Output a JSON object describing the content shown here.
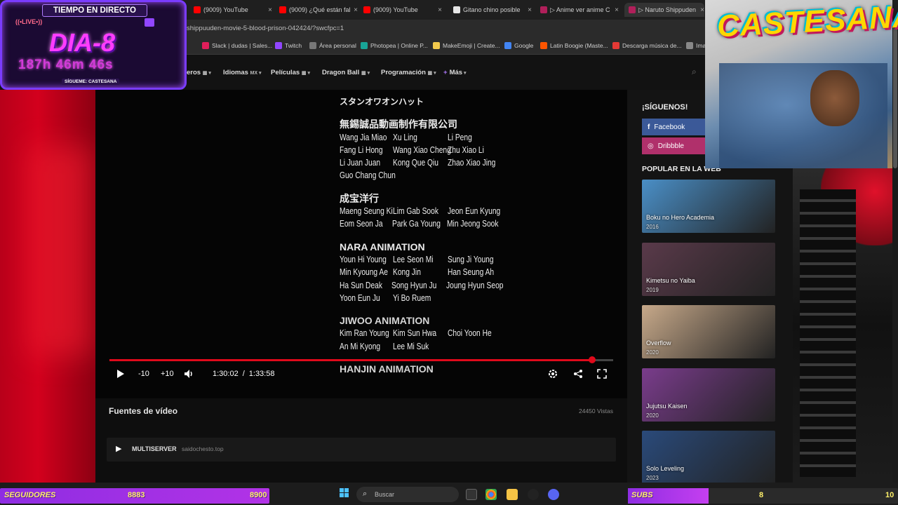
{
  "browser": {
    "tabs": [
      {
        "label": "(9009) YouTube",
        "color": "#ff0000"
      },
      {
        "label": "(9009) ¿Qué están fal",
        "color": "#ff0000"
      },
      {
        "label": "(9009) YouTube",
        "color": "#ff0000"
      },
      {
        "label": "Gitano chino posible",
        "color": "#e6e6e6"
      },
      {
        "label": "▷ Anime ver anime C",
        "color": "#b01f5a"
      },
      {
        "label": "▷ Naruto Shippuden",
        "color": "#b01f5a"
      }
    ],
    "url": "shippuuden-movie-5-blood-prison-042424/?swcfpc=1",
    "bookmarks": [
      {
        "label": "Slack | dudas | Sales...",
        "color": "#e01e5a"
      },
      {
        "label": "Twitch",
        "color": "#9146ff"
      },
      {
        "label": "Área personal",
        "color": "#777777"
      },
      {
        "label": "Photopea | Online P...",
        "color": "#18a497"
      },
      {
        "label": "MakeEmoji | Create...",
        "color": "#f2c94c"
      },
      {
        "label": "Google",
        "color": "#4285f4"
      },
      {
        "label": "Latin Boogie (Maste...",
        "color": "#ff5500"
      },
      {
        "label": "Descarga música de...",
        "color": "#e53935"
      },
      {
        "label": "Ima",
        "color": "#888888"
      }
    ]
  },
  "site_nav": {
    "items": [
      {
        "label": "eros",
        "badge": "▦"
      },
      {
        "label": "Idiomas",
        "badge": "MX"
      },
      {
        "label": "Películas",
        "badge": "▦"
      },
      {
        "label": "Dragon Ball",
        "badge": "▦"
      },
      {
        "label": "Programación",
        "badge": "▦"
      },
      {
        "label": "Más",
        "badge": "+"
      }
    ]
  },
  "credits": {
    "top_line": "スタンオワオンハット",
    "sections": [
      {
        "heading": "無錫誠品動画制作有限公司",
        "rows": [
          [
            "Wang Jia Miao",
            "Xu Ling",
            "Li Peng"
          ],
          [
            "Fang Li Hong",
            "Wang Xiao Cheng",
            "Zhu Xiao Li"
          ],
          [
            "Li Juan Juan",
            "Kong Que Qiu",
            "Zhao Xiao Jing"
          ],
          [
            "Guo Chang Chun",
            "",
            ""
          ]
        ]
      },
      {
        "heading": "成宝洋行",
        "rows": [
          [
            "Maeng Seung Ki",
            "Lim Gab Sook",
            "Jeon Eun Kyung"
          ],
          [
            "Eom Seon Ja",
            "Park Ga Young",
            "Min Jeong Sook"
          ]
        ]
      },
      {
        "heading": "NARA ANIMATION",
        "rows": [
          [
            "Youn Hi Young",
            "Lee Seon Mi",
            "Sung Ji Young"
          ],
          [
            "Min Kyoung Ae",
            "Kong Jin",
            "Han Seung Ah"
          ],
          [
            "Ha Sun Deak",
            "Song Hyun Ju",
            "Joung Hyun Seop"
          ],
          [
            "Yoon Eun Ju",
            "Yi Bo Ruem",
            ""
          ]
        ]
      },
      {
        "heading": "JIWOO ANIMATION",
        "rows": [
          [
            "Kim Ran Young",
            "Kim Sun Hwa",
            "Choi Yoon He"
          ],
          [
            "An Mi Kyong",
            "Lee Mi Suk",
            ""
          ]
        ]
      },
      {
        "heading": "HANJIN ANIMATION",
        "rows": []
      }
    ]
  },
  "player": {
    "rewind_label": "-10",
    "forward_label": "+10",
    "current_time": "1:30:02",
    "separator": "/",
    "duration": "1:33:58",
    "progress_fraction": 0.958
  },
  "sources": {
    "title": "Fuentes de vídeo",
    "views": "24450 Vistas",
    "server_name": "MULTISERVER",
    "server_domain": "saidochesto.top"
  },
  "sidebar": {
    "follow_title": "¡SÍGUENOS!",
    "social": [
      {
        "label": "Facebook",
        "color": "#3b5998"
      },
      {
        "label": "Dribbble",
        "color": "#b0306b"
      }
    ],
    "popular_title": "POPULAR EN LA WEB",
    "popular": [
      {
        "title": "Boku no Hero Academia",
        "year": "2016",
        "color": "#4a8fc7"
      },
      {
        "title": "Kimetsu no Yaiba",
        "year": "2019",
        "color": "#5a3a4a"
      },
      {
        "title": "Overflow",
        "year": "2020",
        "color": "#c7a98a"
      },
      {
        "title": "Jujutsu Kaisen",
        "year": "2020",
        "color": "#7a3c8c"
      },
      {
        "title": "Solo Leveling",
        "year": "2023",
        "color": "#2a4a7a"
      }
    ]
  },
  "stream_overlay": {
    "title": "TIEMPO EN DIRECTO",
    "live": "((•LIVE•))",
    "day": "DIA-8",
    "elapsed": "187h 46m 46s",
    "follow_text": "SÍGUEME: CASTESANA",
    "brand": "CASTESANA",
    "followers_label": "SEGUIDORES",
    "followers_count": "8883",
    "followers_goal": "8900",
    "subs_label": "SUBS",
    "subs_count": "8",
    "subs_goal": "10"
  },
  "taskbar": {
    "search_placeholder": "Buscar"
  }
}
